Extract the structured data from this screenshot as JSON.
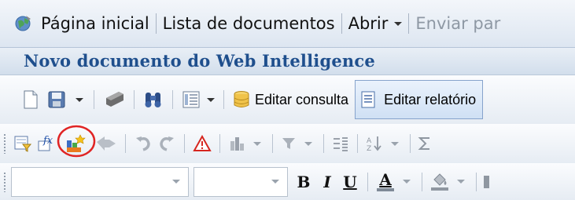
{
  "nav": {
    "home_label": "Página inicial",
    "doc_list_label": "Lista de documentos",
    "open_label": "Abrir",
    "send_label": "Enviar par"
  },
  "title": {
    "text": "Novo documento do Web Intelligence"
  },
  "toolbar1": {
    "edit_query_label": "Editar consulta",
    "edit_report_label": "Editar relatório"
  },
  "toolbar3": {
    "bold_glyph": "B",
    "italic_glyph": "I",
    "underline_glyph": "U",
    "font_color_glyph": "A"
  },
  "icons": {
    "home": "home-globe-icon",
    "new_doc": "new-document-icon",
    "save": "save-icon",
    "print": "print-icon",
    "find": "binoculars-find-icon",
    "view": "view-layout-icon",
    "edit_query": "database-query-icon",
    "edit_report": "report-page-icon",
    "annotation_circle": "#e02424"
  }
}
